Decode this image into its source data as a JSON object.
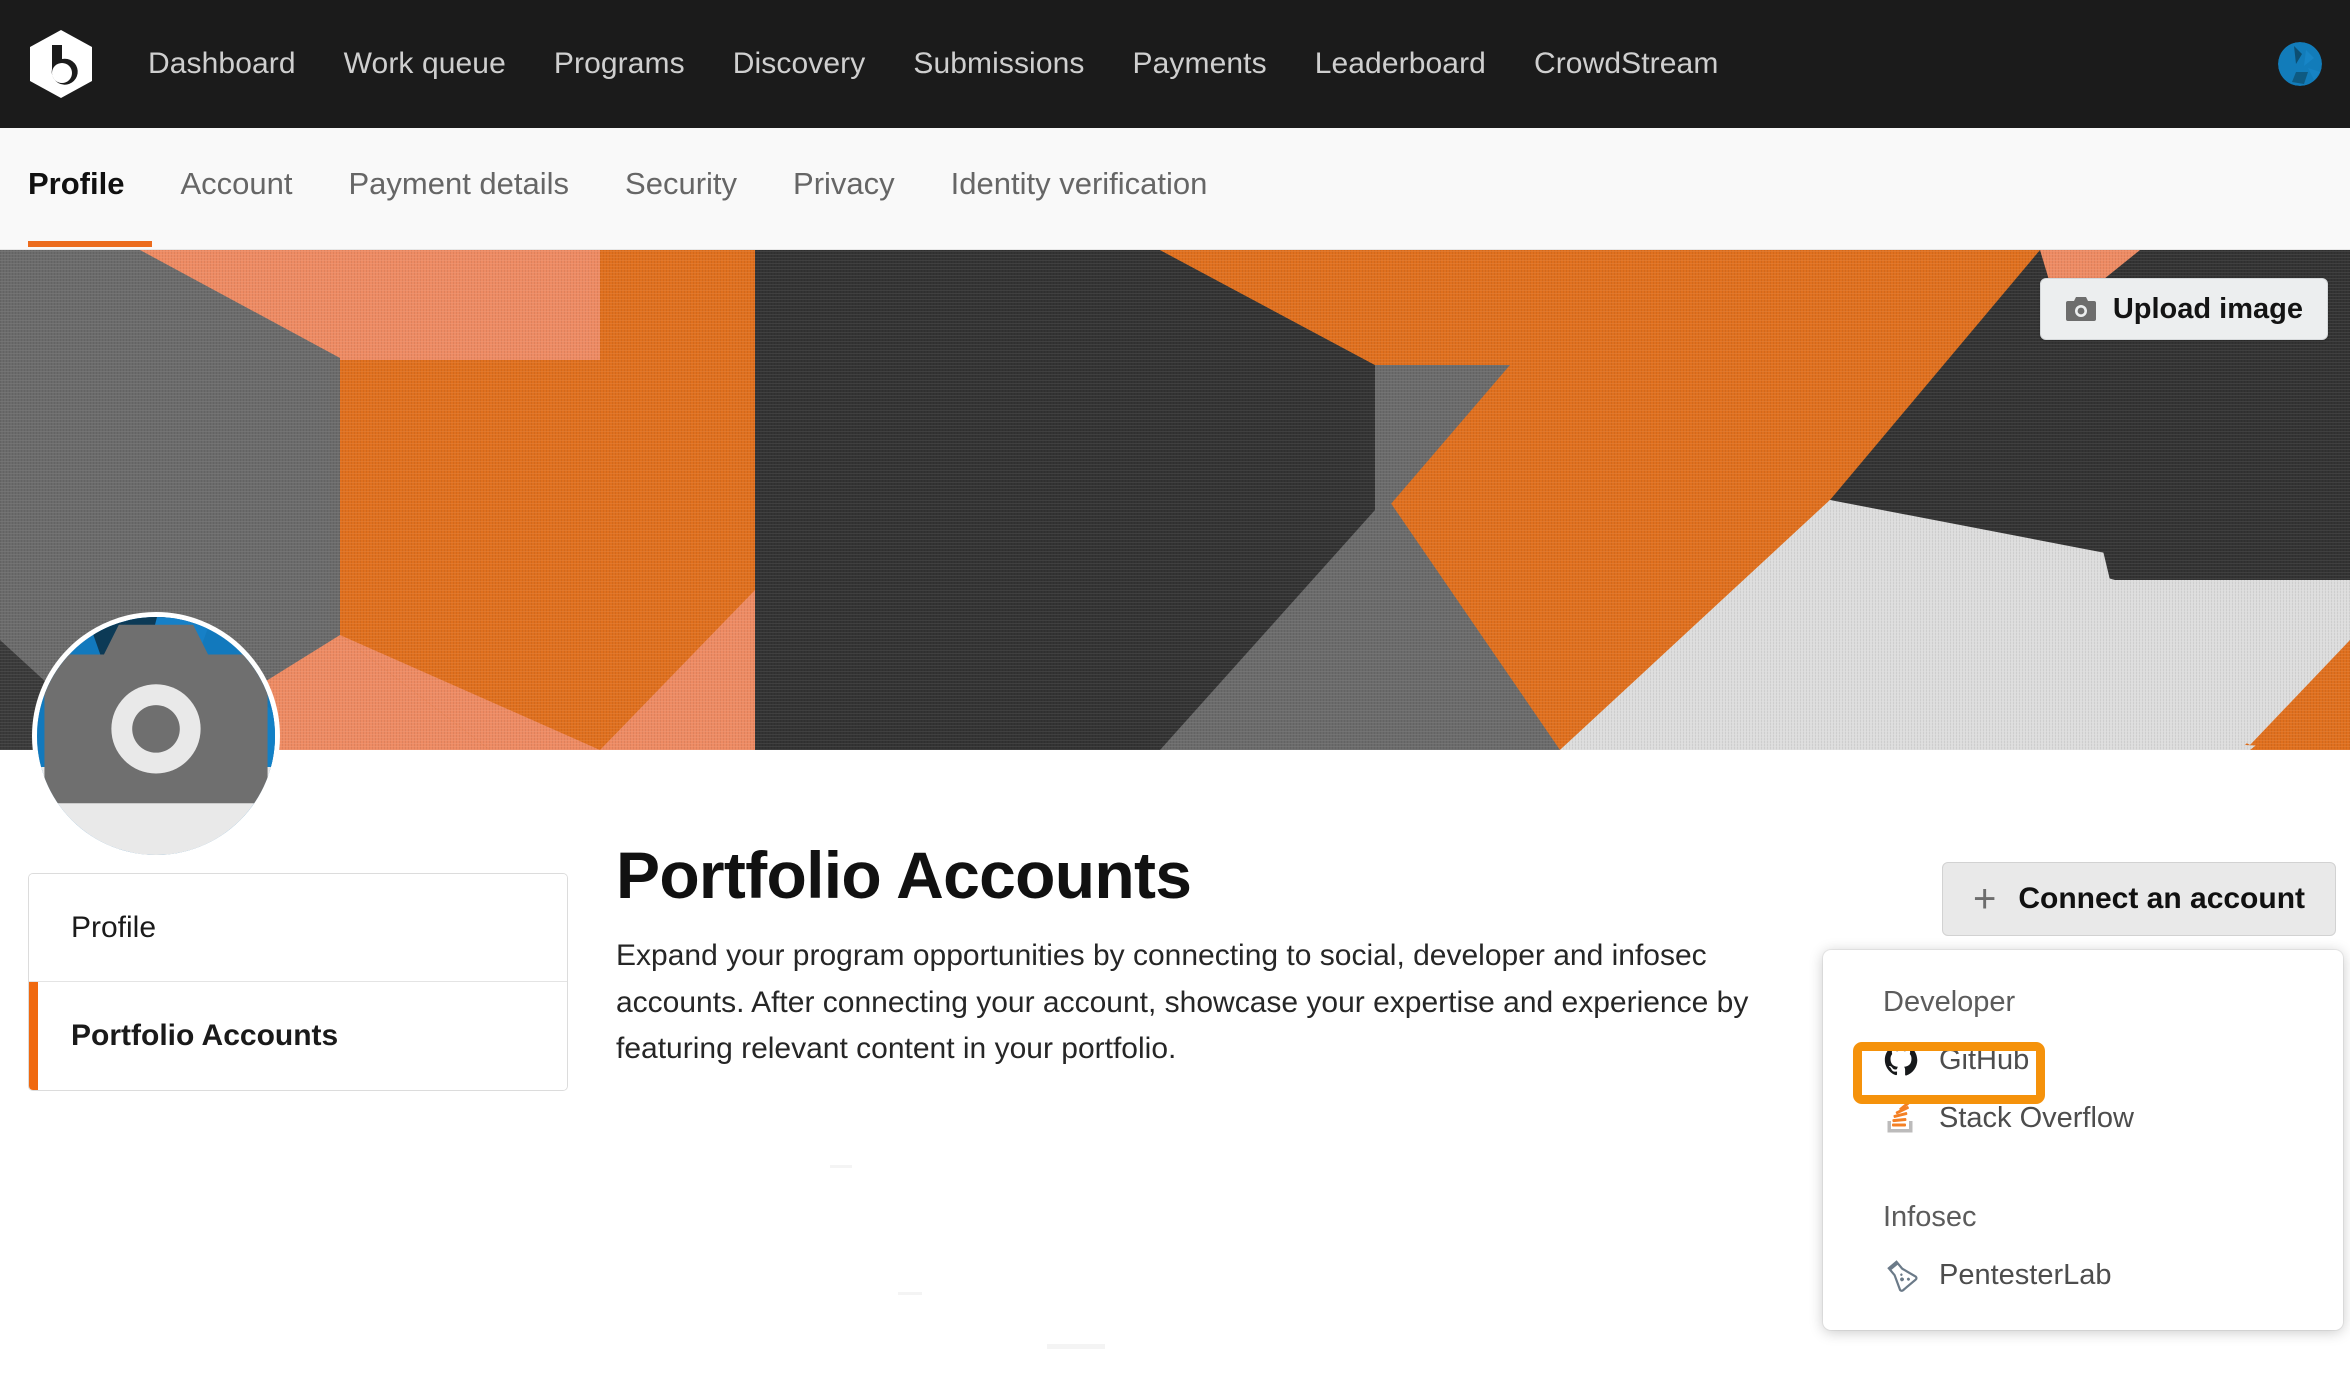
{
  "brand": {
    "logo_icon": "bugcrowd-hexagon-b-logo",
    "accent_orange": "#ec6c1e",
    "highlight_orange": "#f5920b",
    "nav_background": "#1b1b1b"
  },
  "topnav": {
    "links": [
      {
        "label": "Dashboard"
      },
      {
        "label": "Work queue"
      },
      {
        "label": "Programs"
      },
      {
        "label": "Discovery"
      },
      {
        "label": "Submissions"
      },
      {
        "label": "Payments"
      },
      {
        "label": "Leaderboard"
      },
      {
        "label": "CrowdStream"
      }
    ],
    "avatar_icon": "user-avatar"
  },
  "subnav": {
    "tabs": [
      {
        "label": "Profile",
        "active": true
      },
      {
        "label": "Account",
        "active": false
      },
      {
        "label": "Payment details",
        "active": false
      },
      {
        "label": "Security",
        "active": false
      },
      {
        "label": "Privacy",
        "active": false
      },
      {
        "label": "Identity verification",
        "active": false
      }
    ]
  },
  "hero": {
    "upload_button_label": "Upload image",
    "upload_button_icon": "camera-icon",
    "colors": {
      "orange": "#e0701e",
      "salmon": "#ee8b63",
      "gray": "#6b6b6b",
      "dark_gray": "#3a3a3a",
      "light": "#dcdcdc"
    }
  },
  "avatar": {
    "camera_icon": "camera-icon",
    "blue": "#1a79bd",
    "navy": "#0c3a56"
  },
  "sidebar": {
    "items": [
      {
        "label": "Profile",
        "active": false
      },
      {
        "label": "Portfolio Accounts",
        "active": true
      }
    ]
  },
  "main": {
    "title": "Portfolio Accounts",
    "description": "Expand your program opportunities by connecting to social, developer and infosec accounts. After connecting your account, showcase your expertise and experience by featuring relevant content in your portfolio."
  },
  "connect": {
    "button_label": "Connect an account",
    "plus_icon": "plus-icon"
  },
  "dropdown": {
    "groups": [
      {
        "label": "Developer",
        "items": [
          {
            "label": "GitHub",
            "icon": "github-icon",
            "highlighted": true
          },
          {
            "label": "Stack Overflow",
            "icon": "stack-overflow-icon",
            "highlighted": false
          }
        ]
      },
      {
        "label": "Infosec",
        "items": [
          {
            "label": "PentesterLab",
            "icon": "pentesterlab-flask-icon",
            "highlighted": false
          }
        ]
      }
    ]
  }
}
